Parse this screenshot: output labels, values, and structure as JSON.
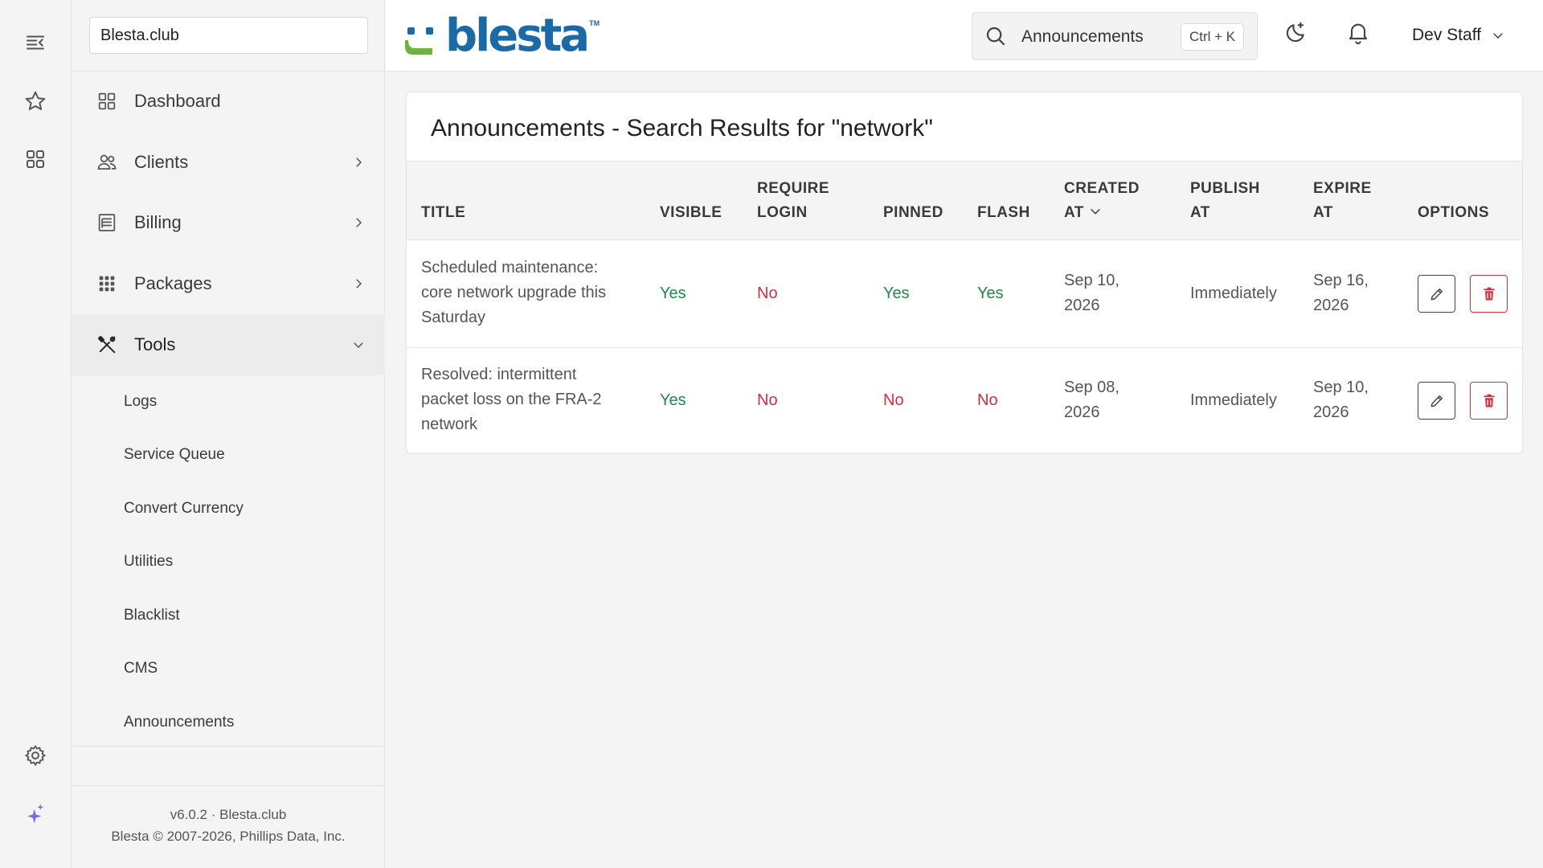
{
  "rail": {
    "items": [
      {
        "name": "menu-collapse-icon"
      },
      {
        "name": "star-icon"
      },
      {
        "name": "grid-icon"
      },
      {
        "name": "gear-icon"
      },
      {
        "name": "sparkle-icon"
      }
    ]
  },
  "sidebar": {
    "company": "Blesta.club",
    "nav": [
      {
        "label": "Dashboard",
        "icon": "dashboard-icon",
        "expandable": false
      },
      {
        "label": "Clients",
        "icon": "users-icon",
        "expandable": true
      },
      {
        "label": "Billing",
        "icon": "billing-icon",
        "expandable": true
      },
      {
        "label": "Packages",
        "icon": "packages-icon",
        "expandable": true
      },
      {
        "label": "Tools",
        "icon": "tools-icon",
        "expandable": true,
        "expanded": true
      }
    ],
    "sub": [
      "Logs",
      "Service Queue",
      "Convert Currency",
      "Utilities",
      "Blacklist",
      "CMS",
      "Announcements"
    ],
    "footer": {
      "version": "v6.0.2 · Blesta.club",
      "copyright": "Blesta © 2007-2026, Phillips Data, Inc."
    }
  },
  "header": {
    "logo_text": "blesta",
    "logo_tm": "TM",
    "search_value": "Announcements",
    "search_shortcut": "Ctrl + K",
    "user": "Dev Staff"
  },
  "panel": {
    "title": "Announcements - Search Results for \"network\"",
    "columns": {
      "title": "Title",
      "visible": "Visible",
      "require_login_1": "Require",
      "require_login_2": "Login",
      "pinned": "Pinned",
      "flash": "Flash",
      "created_1": "Created",
      "created_2": "At",
      "publish_1": "Publish",
      "publish_2": "At",
      "expire_1": "Expire",
      "expire_2": "At",
      "options": "Options"
    },
    "rows": [
      {
        "title_lines": [
          "Scheduled maintenance:",
          "core network upgrade this",
          "Saturday"
        ],
        "visible": "Yes",
        "require_login": "No",
        "pinned": "Yes",
        "flash": "Yes",
        "created_lines": [
          "Sep 10,",
          "2026"
        ],
        "publish": "Immediately",
        "expire_lines": [
          "Sep 16,",
          "2026"
        ]
      },
      {
        "title_lines": [
          "Resolved: intermittent",
          "packet loss on the FRA-2",
          "network"
        ],
        "visible": "Yes",
        "require_login": "No",
        "pinned": "No",
        "flash": "No",
        "created_lines": [
          "Sep 08,",
          "2026"
        ],
        "publish": "Immediately",
        "expire_lines": [
          "Sep 10,",
          "2026"
        ]
      }
    ]
  },
  "colors": {
    "yes": "#22874a",
    "no": "#d42d3e",
    "brand_blue": "#1b6aa5",
    "brand_green": "#6db33f"
  }
}
